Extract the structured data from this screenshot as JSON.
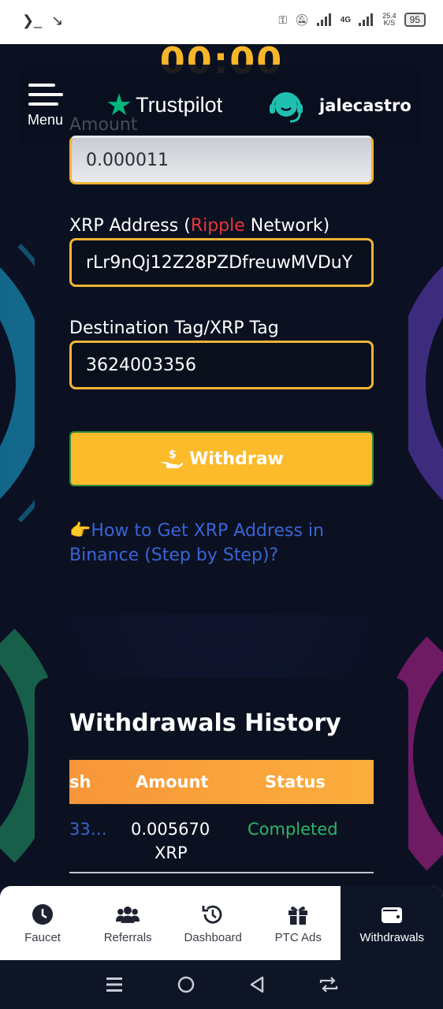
{
  "status_bar": {
    "left_icons": [
      "terminal-icon",
      "missed-call-icon"
    ],
    "network": "4G",
    "speed": "25.4",
    "speed_unit": "K/S",
    "battery": "95"
  },
  "countdown": "00:00",
  "header": {
    "menu_label": "Menu",
    "brand": "Trustpilot",
    "username": "jalecastro"
  },
  "form": {
    "amount_label": "Amount",
    "amount_value": "0.000011",
    "xrp_label_prefix": "XRP Address (",
    "xrp_label_network": "Ripple",
    "xrp_label_suffix": " Network)",
    "xrp_address": "rLr9nQj12Z28PZDfreuwMVDuY",
    "tag_label": "Destination Tag/XRP Tag",
    "tag_value": "3624003356",
    "withdraw_button": "Withdraw",
    "help_emoji": "👉",
    "help_link": "How to Get XRP Address in Binance (Step by Step)?"
  },
  "history": {
    "title": "Withdrawals History",
    "columns": [
      "sh",
      "Amount",
      "Status"
    ],
    "rows": [
      {
        "hash": "33…",
        "amount": "0.005670",
        "currency": "XRP",
        "status": "Completed"
      }
    ]
  },
  "bottom_nav": [
    {
      "label": "Faucet",
      "icon": "clock-icon"
    },
    {
      "label": "Referrals",
      "icon": "users-icon"
    },
    {
      "label": "Dashboard",
      "icon": "history-icon"
    },
    {
      "label": "PTC Ads",
      "icon": "gift-icon"
    },
    {
      "label": "Withdrawals",
      "icon": "wallet-icon",
      "active": true
    }
  ],
  "colors": {
    "accent": "#f2b532",
    "button": "#fbbb2b",
    "link": "#3a64d8",
    "success": "#2fb56a",
    "ripple": "#e5383b"
  }
}
